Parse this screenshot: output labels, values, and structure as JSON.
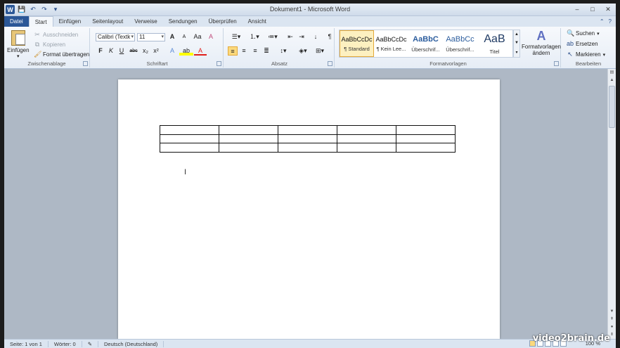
{
  "window": {
    "title": "Dokument1 - Microsoft Word",
    "controls": [
      "–",
      "□",
      "✕"
    ]
  },
  "qat": {
    "app_icon": "W",
    "items": [
      "save-icon",
      "undo-icon",
      "redo-icon",
      "customize-icon"
    ]
  },
  "tabs": [
    {
      "label": "Datei"
    },
    {
      "label": "Start"
    },
    {
      "label": "Einfügen"
    },
    {
      "label": "Seitenlayout"
    },
    {
      "label": "Verweise"
    },
    {
      "label": "Sendungen"
    },
    {
      "label": "Überprüfen"
    },
    {
      "label": "Ansicht"
    }
  ],
  "ribbon": {
    "clipboard": {
      "label": "Zwischenablage",
      "paste": "Einfügen",
      "cut": "Ausschneiden",
      "copy": "Kopieren",
      "format_painter": "Format übertragen"
    },
    "font": {
      "label": "Schriftart",
      "family": "Calibri (Textk",
      "size": "11",
      "grow": "A",
      "shrink": "A",
      "case": "Aa",
      "clear": "A",
      "bold": "F",
      "italic": "K",
      "underline": "U",
      "strike": "abc",
      "subscript": "x₂",
      "superscript": "x²",
      "effects": "A",
      "highlight": "ab",
      "color": "A"
    },
    "paragraph": {
      "label": "Absatz"
    },
    "styles": {
      "label": "Formatvorlagen",
      "items": [
        {
          "sample": "AaBbCcDc",
          "name": "¶ Standard"
        },
        {
          "sample": "AaBbCcDc",
          "name": "¶ Kein Lee..."
        },
        {
          "sample": "AaBbC",
          "name": "Überschrif..."
        },
        {
          "sample": "AaBbCc",
          "name": "Überschrif..."
        },
        {
          "sample": "AaB",
          "name": "Titel"
        }
      ],
      "change_styles_line1": "Formatvorlagen",
      "change_styles_line2": "ändern"
    },
    "editing": {
      "label": "Bearbeiten",
      "find": "Suchen",
      "replace": "Ersetzen",
      "select": "Markieren"
    }
  },
  "document": {
    "table": {
      "rows": 3,
      "cols": 5
    }
  },
  "statusbar": {
    "page": "Seite: 1 von 1",
    "words": "Wörter: 0",
    "language": "Deutsch (Deutschland)",
    "zoom": "100 %"
  },
  "watermark": "video2brain.de",
  "colors": {
    "file_tab": "#2b5797",
    "selected_style": "#fbd97c",
    "highlight_yellow": "#ffff00",
    "font_color_red": "#e0201b"
  }
}
